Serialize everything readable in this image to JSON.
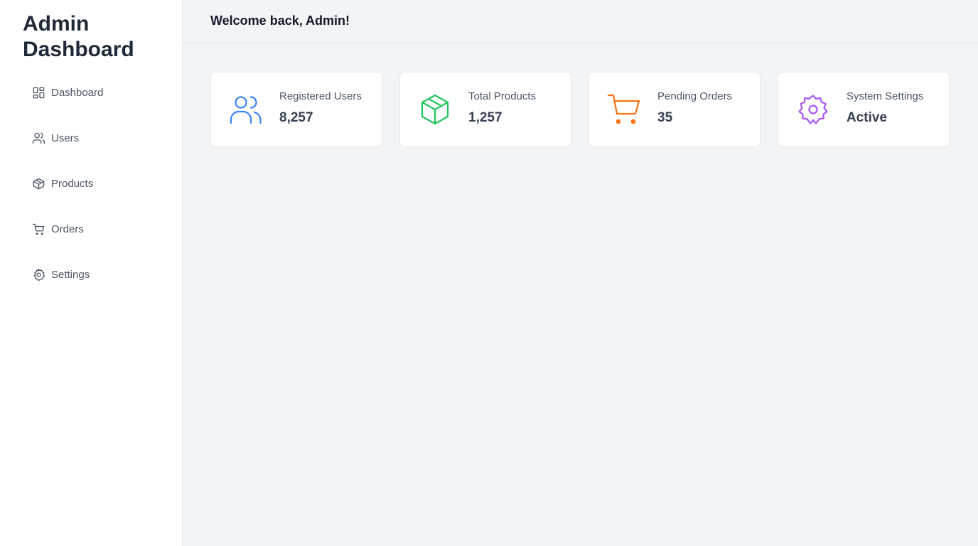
{
  "sidebar": {
    "brand": "Admin Dashboard",
    "items": [
      {
        "label": "Dashboard",
        "icon": "dashboard-icon"
      },
      {
        "label": "Users",
        "icon": "users-icon"
      },
      {
        "label": "Products",
        "icon": "box-icon"
      },
      {
        "label": "Orders",
        "icon": "cart-icon"
      },
      {
        "label": "Settings",
        "icon": "gear-icon"
      }
    ]
  },
  "header": {
    "welcome": "Welcome back, Admin!"
  },
  "cards": [
    {
      "label": "Registered Users",
      "value": "8,257",
      "icon": "users-icon",
      "color": "#3b82f6"
    },
    {
      "label": "Total Products",
      "value": "1,257",
      "icon": "box-icon",
      "color": "#22c55e"
    },
    {
      "label": "Pending Orders",
      "value": "35",
      "icon": "cart-icon",
      "color": "#f97316"
    },
    {
      "label": "System Settings",
      "value": "Active",
      "icon": "gear-icon",
      "color": "#a855f7"
    }
  ],
  "colors": {
    "background": "#f3f4f6",
    "sidebar_bg": "#ffffff",
    "border": "#e5e7eb",
    "text": "#1f2937",
    "muted_text": "#4b5563"
  }
}
